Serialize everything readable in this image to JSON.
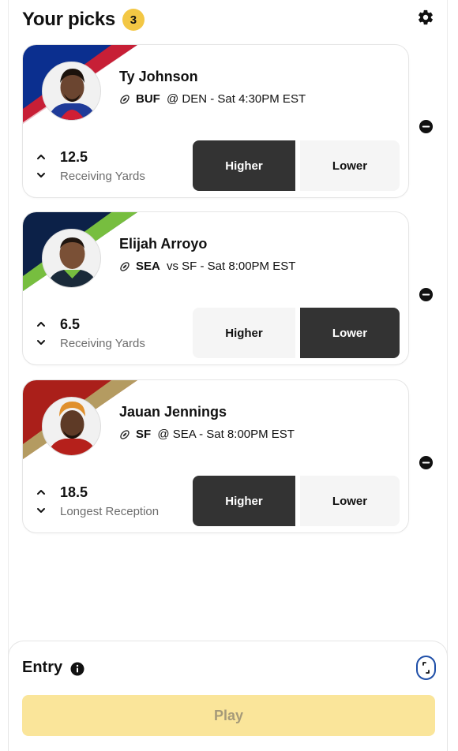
{
  "header": {
    "title": "Your picks",
    "count": "3",
    "settings_icon": "gear-icon"
  },
  "picks": [
    {
      "player": "Ty Johnson",
      "team": "BUF",
      "matchup_rest": " @ DEN - Sat 4:30PM EST",
      "line": "12.5",
      "stat": "Receiving Yards",
      "higher_label": "Higher",
      "lower_label": "Lower",
      "selected": "Higher",
      "team_colors": [
        "#0b2f8f",
        "#c71f36",
        "#ffffff"
      ]
    },
    {
      "player": "Elijah Arroyo",
      "team": "SEA",
      "matchup_rest": " vs SF - Sat 8:00PM EST",
      "line": "6.5",
      "stat": "Receiving Yards",
      "higher_label": "Higher",
      "lower_label": "Lower",
      "selected": "Lower",
      "team_colors": [
        "#0c2148",
        "#77be3f",
        "#ffffff"
      ]
    },
    {
      "player": "Jauan Jennings",
      "team": "SF",
      "matchup_rest": " @ SEA - Sat 8:00PM EST",
      "line": "18.5",
      "stat": "Longest Reception",
      "higher_label": "Higher",
      "lower_label": "Lower",
      "selected": "Higher",
      "team_colors": [
        "#aa1f1a",
        "#b49b61",
        "#ffffff"
      ]
    }
  ],
  "entry": {
    "title": "Entry",
    "play_label": "Play",
    "info_icon": "info-icon",
    "expand_icon": "expand-icon"
  },
  "colors": {
    "accent_yellow": "#f3c744",
    "selected_choice": "#333333",
    "play_disabled": "#fae59a"
  }
}
